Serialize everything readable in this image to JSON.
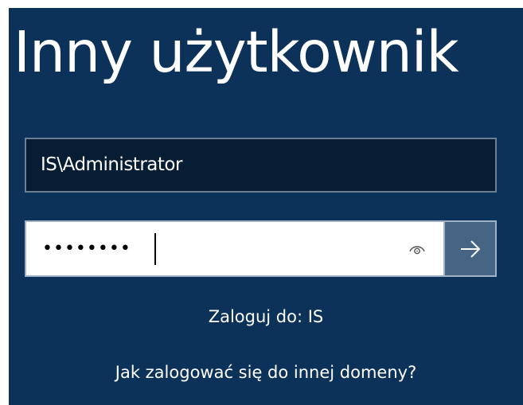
{
  "login": {
    "title": "Inny użytkownik",
    "username": {
      "value": "IS\\Administrator"
    },
    "password": {
      "masked_value": "••••••••"
    },
    "reveal_icon": "eye-icon",
    "submit_icon": "arrow-right-icon",
    "sign_in_to": "Zaloguj do: IS",
    "other_domain_link": "Jak zalogować się do innej domeny?"
  },
  "colors": {
    "background": "#0c3259",
    "username_field_bg": "#071d33",
    "submit_button_bg": "#466483",
    "text": "#ffffff"
  }
}
